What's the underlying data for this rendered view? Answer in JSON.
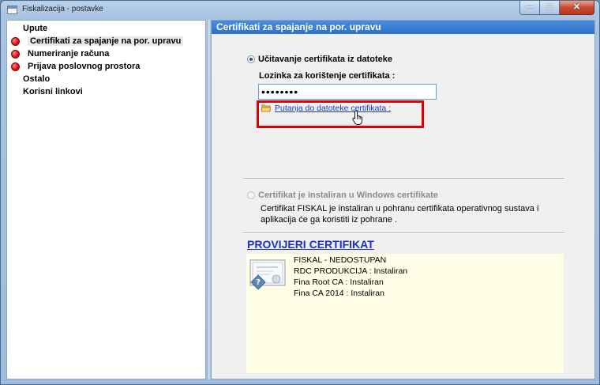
{
  "window": {
    "title": "Fiskalizacija - postavke"
  },
  "nav": {
    "items": [
      {
        "label": "Upute",
        "dot": false,
        "selected": false
      },
      {
        "label": "Certifikati za spajanje na por. upravu",
        "dot": true,
        "selected": true
      },
      {
        "label": "Numeriranje računa",
        "dot": true,
        "selected": false
      },
      {
        "label": "Prijava poslovnog prostora",
        "dot": true,
        "selected": false
      },
      {
        "label": "Ostalo",
        "dot": false,
        "selected": false
      },
      {
        "label": "Korisni linkovi",
        "dot": false,
        "selected": false
      }
    ]
  },
  "content": {
    "header": "Certifikati za spajanje na por. upravu",
    "option_file": {
      "label": "Učitavanje certifikata iz datoteke",
      "password_label": "Lozinka za korištenje certifikata :",
      "password_value": "••••••••",
      "path_link": "Putanja do datoteke certifikata :"
    },
    "option_windows": {
      "label": "Certifikat je instaliran u Windows certifikate",
      "description_line1": "Certifikat FISKAL je instaliran u pohranu certifikata operativnog sustava i",
      "description_line2": "aplikacija će ga koristiti iz pohrane ."
    },
    "verify": {
      "title": "PROVIJERI CERTIFIKAT",
      "lines": [
        "FISKAL - NEDOSTUPAN",
        "RDC PRODUKCIJA : Instaliran",
        "Fina  Root CA : Instaliran",
        "Fina  CA 2014 : Instaliran"
      ]
    }
  },
  "colors": {
    "header_blue": "#3a7fd0",
    "link_blue": "#1a39c9",
    "highlight_red": "#e00000",
    "status_red": "#e01010"
  }
}
